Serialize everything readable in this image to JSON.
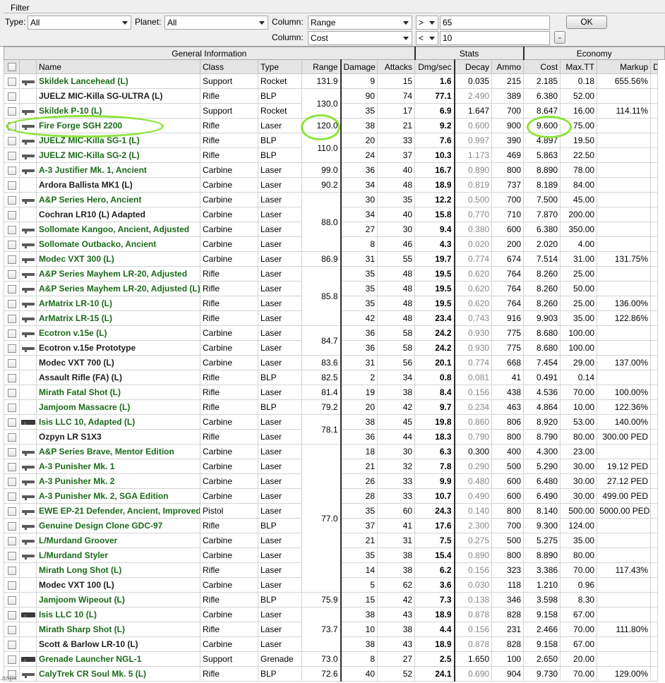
{
  "filter": {
    "title": "Filter",
    "type_label": "Type:",
    "type_value": "All",
    "planet_label": "Planet:",
    "planet_value": "All",
    "column_label": "Column:",
    "col1_value": "Range",
    "op1_value": ">",
    "val1": "65",
    "col2_value": "Cost",
    "op2_value": "<",
    "val2": "10",
    "ok_label": "OK",
    "minus_label": "-"
  },
  "groups": {
    "general": "General Information",
    "stats": "Stats",
    "economy": "Economy"
  },
  "headers": {
    "name": "Name",
    "class": "Class",
    "type": "Type",
    "range": "Range",
    "damage": "Damage",
    "attacks": "Attacks",
    "dmgsec": "Dmg/sec",
    "decay": "Decay",
    "ammo": "Ammo",
    "cost": "Cost",
    "maxtt": "Max.TT",
    "markup": "Markup",
    "dr": "Dr"
  },
  "accent": {
    "highlight": "#8ee33a",
    "name_green": "#1a6b1a"
  },
  "rows": [
    {
      "icon": "rifle-icon",
      "name": "Skildek Lancehead (L)",
      "color": "g",
      "class": "Support",
      "type": "Rocket",
      "range": "131.9",
      "damage": "9",
      "attacks": "15",
      "dmgsec": "1.6",
      "decay": "0.035",
      "decay_gray": false,
      "ammo": "215",
      "cost": "2.185",
      "maxtt": "0.18",
      "markup": "655.56%"
    },
    {
      "icon": "",
      "name": "JUELZ MIC-Killa SG-ULTRA (L)",
      "color": "k",
      "class": "Rifle",
      "type": "BLP",
      "range": "130.0",
      "range_span": 2,
      "damage": "90",
      "attacks": "74",
      "dmgsec": "77.1",
      "decay": "2.490",
      "decay_gray": true,
      "ammo": "389",
      "cost": "6.380",
      "maxtt": "52.00",
      "markup": ""
    },
    {
      "icon": "rifle-icon",
      "name": "Skildek P-10 (L)",
      "color": "g",
      "class": "Support",
      "type": "Rocket",
      "damage": "35",
      "attacks": "17",
      "dmgsec": "6.9",
      "decay": "1.647",
      "decay_gray": false,
      "ammo": "700",
      "cost": "8.647",
      "maxtt": "16.00",
      "markup": "114.11%"
    },
    {
      "icon": "rifle-icon",
      "name": "Fire Forge SGH 2200",
      "color": "g",
      "class": "Rifle",
      "type": "Laser",
      "range": "120.0",
      "damage": "38",
      "attacks": "21",
      "dmgsec": "9.2",
      "decay": "0.600",
      "decay_gray": true,
      "ammo": "900",
      "cost": "9.600",
      "maxtt": "75.00",
      "markup": ""
    },
    {
      "icon": "rifle-icon",
      "name": "JUELZ MIC-Killa SG-1 (L)",
      "color": "g",
      "class": "Rifle",
      "type": "BLP",
      "range": "110.0",
      "range_span": 2,
      "damage": "20",
      "attacks": "33",
      "dmgsec": "7.6",
      "decay": "0.997",
      "decay_gray": true,
      "ammo": "390",
      "cost": "4.897",
      "maxtt": "19.50",
      "markup": ""
    },
    {
      "icon": "rifle-icon",
      "name": "JUELZ MIC-Killa SG-2 (L)",
      "color": "g",
      "class": "Rifle",
      "type": "BLP",
      "damage": "24",
      "attacks": "37",
      "dmgsec": "10.3",
      "decay": "1.173",
      "decay_gray": true,
      "ammo": "469",
      "cost": "5.863",
      "maxtt": "22.50",
      "markup": ""
    },
    {
      "icon": "carbine-icon",
      "name": "A-3 Justifier Mk. 1, Ancient",
      "color": "g",
      "class": "Carbine",
      "type": "Laser",
      "range": "99.0",
      "damage": "36",
      "attacks": "40",
      "dmgsec": "16.7",
      "decay": "0.890",
      "decay_gray": true,
      "ammo": "800",
      "cost": "8.890",
      "maxtt": "78.00",
      "markup": ""
    },
    {
      "icon": "",
      "name": "Ardora Ballista MK1 (L)",
      "color": "k",
      "class": "Carbine",
      "type": "Laser",
      "range": "90.2",
      "damage": "34",
      "attacks": "48",
      "dmgsec": "18.9",
      "decay": "0.819",
      "decay_gray": true,
      "ammo": "737",
      "cost": "8.189",
      "maxtt": "84.00",
      "markup": ""
    },
    {
      "icon": "carbine-icon",
      "name": "A&P Series Hero, Ancient",
      "color": "g",
      "class": "Carbine",
      "type": "Laser",
      "range": "88.0",
      "range_span": 4,
      "damage": "30",
      "attacks": "35",
      "dmgsec": "12.2",
      "decay": "0.500",
      "decay_gray": true,
      "ammo": "700",
      "cost": "7.500",
      "maxtt": "45.00",
      "markup": ""
    },
    {
      "icon": "",
      "name": "Cochran LR10 (L) Adapted",
      "color": "k",
      "class": "Carbine",
      "type": "Laser",
      "damage": "34",
      "attacks": "40",
      "dmgsec": "15.8",
      "decay": "0.770",
      "decay_gray": true,
      "ammo": "710",
      "cost": "7.870",
      "maxtt": "200.00",
      "markup": ""
    },
    {
      "icon": "carbine-icon",
      "name": "Sollomate Kangoo, Ancient, Adjusted",
      "color": "g",
      "class": "Carbine",
      "type": "Laser",
      "damage": "27",
      "attacks": "30",
      "dmgsec": "9.4",
      "decay": "0.380",
      "decay_gray": true,
      "ammo": "600",
      "cost": "6.380",
      "maxtt": "350.00",
      "markup": ""
    },
    {
      "icon": "carbine-icon",
      "name": "Sollomate Outbacko, Ancient",
      "color": "g",
      "class": "Carbine",
      "type": "Laser",
      "damage": "8",
      "attacks": "46",
      "dmgsec": "4.3",
      "decay": "0.020",
      "decay_gray": true,
      "ammo": "200",
      "cost": "2.020",
      "maxtt": "4.00",
      "markup": ""
    },
    {
      "icon": "carbine-icon",
      "name": "Modec VXT 300 (L)",
      "color": "g",
      "class": "Carbine",
      "type": "Laser",
      "range": "86.9",
      "damage": "31",
      "attacks": "55",
      "dmgsec": "19.7",
      "decay": "0.774",
      "decay_gray": true,
      "ammo": "674",
      "cost": "7.514",
      "maxtt": "31.00",
      "markup": "131.75%"
    },
    {
      "icon": "rifle-icon",
      "name": "A&P Series Mayhem LR-20, Adjusted",
      "color": "g",
      "class": "Rifle",
      "type": "Laser",
      "range": "85.8",
      "range_span": 4,
      "damage": "35",
      "attacks": "48",
      "dmgsec": "19.5",
      "decay": "0.620",
      "decay_gray": true,
      "ammo": "764",
      "cost": "8.260",
      "maxtt": "25.00",
      "markup": ""
    },
    {
      "icon": "rifle-icon",
      "name": "A&P Series Mayhem LR-20, Adjusted (L)",
      "color": "g",
      "class": "Rifle",
      "type": "Laser",
      "damage": "35",
      "attacks": "48",
      "dmgsec": "19.5",
      "decay": "0.620",
      "decay_gray": true,
      "ammo": "764",
      "cost": "8.260",
      "maxtt": "50.00",
      "markup": ""
    },
    {
      "icon": "rifle-icon",
      "name": "ArMatrix LR-10 (L)",
      "color": "g",
      "class": "Rifle",
      "type": "Laser",
      "damage": "35",
      "attacks": "48",
      "dmgsec": "19.5",
      "decay": "0.620",
      "decay_gray": true,
      "ammo": "764",
      "cost": "8.260",
      "maxtt": "25.00",
      "markup": "136.00%"
    },
    {
      "icon": "rifle-icon",
      "name": "ArMatrix LR-15 (L)",
      "color": "g",
      "class": "Rifle",
      "type": "Laser",
      "damage": "42",
      "attacks": "48",
      "dmgsec": "23.4",
      "decay": "0.743",
      "decay_gray": true,
      "ammo": "916",
      "cost": "9.903",
      "maxtt": "35.00",
      "markup": "122.86%"
    },
    {
      "icon": "pistol-icon",
      "name": "Ecotron v.15e (L)",
      "color": "g",
      "class": "Carbine",
      "type": "Laser",
      "range": "84.7",
      "range_span": 2,
      "damage": "36",
      "attacks": "58",
      "dmgsec": "24.2",
      "decay": "0.930",
      "decay_gray": true,
      "ammo": "775",
      "cost": "8.680",
      "maxtt": "100.00",
      "markup": ""
    },
    {
      "icon": "pistol-icon",
      "name": "Ecotron v.15e Prototype",
      "color": "k",
      "class": "Carbine",
      "type": "Laser",
      "damage": "36",
      "attacks": "58",
      "dmgsec": "24.2",
      "decay": "0.930",
      "decay_gray": true,
      "ammo": "775",
      "cost": "8.680",
      "maxtt": "100.00",
      "markup": ""
    },
    {
      "icon": "",
      "name": "Modec VXT 700 (L)",
      "color": "k",
      "class": "Carbine",
      "type": "Laser",
      "range": "83.6",
      "damage": "31",
      "attacks": "56",
      "dmgsec": "20.1",
      "decay": "0.774",
      "decay_gray": true,
      "ammo": "668",
      "cost": "7.454",
      "maxtt": "29.00",
      "markup": "137.00%"
    },
    {
      "icon": "",
      "name": "Assault Rifle (FA) (L)",
      "color": "k",
      "class": "Rifle",
      "type": "BLP",
      "range": "82.5",
      "damage": "2",
      "attacks": "34",
      "dmgsec": "0.8",
      "decay": "0.081",
      "decay_gray": true,
      "ammo": "41",
      "cost": "0.491",
      "maxtt": "0.14",
      "markup": ""
    },
    {
      "icon": "",
      "name": "Mirath Fatal Shot (L)",
      "color": "g",
      "class": "Rifle",
      "type": "Laser",
      "range": "81.4",
      "damage": "19",
      "attacks": "38",
      "dmgsec": "8.4",
      "decay": "0.156",
      "decay_gray": true,
      "ammo": "438",
      "cost": "4.536",
      "maxtt": "70.00",
      "markup": "100.00%"
    },
    {
      "icon": "",
      "name": "Jamjoom Massacre (L)",
      "color": "g",
      "class": "Rifle",
      "type": "BLP",
      "range": "79.2",
      "damage": "20",
      "attacks": "42",
      "dmgsec": "9.7",
      "decay": "0.234",
      "decay_gray": true,
      "ammo": "463",
      "cost": "4.864",
      "maxtt": "10.00",
      "markup": "122.36%"
    },
    {
      "icon": "heavy-gun-icon",
      "name": "Isis LLC 10, Adapted (L)",
      "color": "g",
      "class": "Carbine",
      "type": "Laser",
      "range": "78.1",
      "range_span": 2,
      "damage": "38",
      "attacks": "45",
      "dmgsec": "19.8",
      "decay": "0.860",
      "decay_gray": true,
      "ammo": "806",
      "cost": "8.920",
      "maxtt": "53.00",
      "markup": "140.00%"
    },
    {
      "icon": "",
      "name": "Ozpyn LR S1X3",
      "color": "k",
      "class": "Rifle",
      "type": "Laser",
      "damage": "36",
      "attacks": "44",
      "dmgsec": "18.3",
      "decay": "0.790",
      "decay_gray": true,
      "ammo": "800",
      "cost": "8.790",
      "maxtt": "80.00",
      "markup": "300.00 PED"
    },
    {
      "icon": "carbine-icon",
      "name": "A&P Series Brave, Mentor Edition",
      "color": "g",
      "class": "Carbine",
      "type": "Laser",
      "range": "77.0",
      "range_span": 10,
      "damage": "18",
      "attacks": "30",
      "dmgsec": "6.3",
      "decay": "0.300",
      "decay_gray": false,
      "ammo": "400",
      "cost": "4.300",
      "maxtt": "23.00",
      "markup": ""
    },
    {
      "icon": "carbine-icon",
      "name": "A-3 Punisher Mk. 1",
      "color": "g",
      "class": "Carbine",
      "type": "Laser",
      "damage": "21",
      "attacks": "32",
      "dmgsec": "7.8",
      "decay": "0.290",
      "decay_gray": true,
      "ammo": "500",
      "cost": "5.290",
      "maxtt": "30.00",
      "markup": "19.12 PED"
    },
    {
      "icon": "carbine-icon",
      "name": "A-3 Punisher Mk. 2",
      "color": "g",
      "class": "Carbine",
      "type": "Laser",
      "damage": "26",
      "attacks": "33",
      "dmgsec": "9.9",
      "decay": "0.480",
      "decay_gray": true,
      "ammo": "600",
      "cost": "6.480",
      "maxtt": "30.00",
      "markup": "27.12 PED"
    },
    {
      "icon": "carbine-icon",
      "name": "A-3 Punisher Mk. 2, SGA Edition",
      "color": "g",
      "class": "Carbine",
      "type": "Laser",
      "damage": "28",
      "attacks": "33",
      "dmgsec": "10.7",
      "decay": "0.490",
      "decay_gray": true,
      "ammo": "600",
      "cost": "6.490",
      "maxtt": "30.00",
      "markup": "499.00 PED"
    },
    {
      "icon": "pistol-icon",
      "name": "EWE EP-21 Defender, Ancient, Improved",
      "color": "g",
      "class": "Pistol",
      "type": "Laser",
      "damage": "35",
      "attacks": "60",
      "dmgsec": "24.3",
      "decay": "0.140",
      "decay_gray": true,
      "ammo": "800",
      "cost": "8.140",
      "maxtt": "500.00",
      "markup": "5000.00 PED"
    },
    {
      "icon": "rifle-icon",
      "name": "Genuine Design Clone GDC-97",
      "color": "g",
      "class": "Rifle",
      "type": "BLP",
      "damage": "37",
      "attacks": "41",
      "dmgsec": "17.6",
      "decay": "2.300",
      "decay_gray": true,
      "ammo": "700",
      "cost": "9.300",
      "maxtt": "124.00",
      "markup": ""
    },
    {
      "icon": "carbine-icon",
      "name": "L/Murdand Groover",
      "color": "g",
      "class": "Carbine",
      "type": "Laser",
      "damage": "21",
      "attacks": "31",
      "dmgsec": "7.5",
      "decay": "0.275",
      "decay_gray": true,
      "ammo": "500",
      "cost": "5.275",
      "maxtt": "35.00",
      "markup": ""
    },
    {
      "icon": "carbine-icon",
      "name": "L/Murdand Styler",
      "color": "g",
      "class": "Carbine",
      "type": "Laser",
      "damage": "35",
      "attacks": "38",
      "dmgsec": "15.4",
      "decay": "0.890",
      "decay_gray": true,
      "ammo": "800",
      "cost": "8.890",
      "maxtt": "80.00",
      "markup": ""
    },
    {
      "icon": "",
      "name": "Mirath Long Shot (L)",
      "color": "g",
      "class": "Rifle",
      "type": "Laser",
      "damage": "14",
      "attacks": "38",
      "dmgsec": "6.2",
      "decay": "0.156",
      "decay_gray": true,
      "ammo": "323",
      "cost": "3.386",
      "maxtt": "70.00",
      "markup": "117.43%"
    },
    {
      "icon": "",
      "name": "Modec VXT 100 (L)",
      "color": "k",
      "class": "Carbine",
      "type": "Laser",
      "damage": "5",
      "attacks": "62",
      "dmgsec": "3.6",
      "decay": "0.030",
      "decay_gray": true,
      "ammo": "118",
      "cost": "1.210",
      "maxtt": "0.96",
      "markup": ""
    },
    {
      "icon": "",
      "name": "Jamjoom Wipeout (L)",
      "color": "g",
      "class": "Rifle",
      "type": "BLP",
      "range": "75.9",
      "damage": "15",
      "attacks": "42",
      "dmgsec": "7.3",
      "decay": "0.138",
      "decay_gray": true,
      "ammo": "346",
      "cost": "3.598",
      "maxtt": "8.30",
      "markup": ""
    },
    {
      "icon": "heavy-gun-icon",
      "name": "Isis LLC 10 (L)",
      "color": "g",
      "class": "Carbine",
      "type": "Laser",
      "range": "73.7",
      "range_span": 3,
      "damage": "38",
      "attacks": "43",
      "dmgsec": "18.9",
      "decay": "0.878",
      "decay_gray": true,
      "ammo": "828",
      "cost": "9.158",
      "maxtt": "67.00",
      "markup": ""
    },
    {
      "icon": "",
      "name": "Mirath Sharp Shot (L)",
      "color": "g",
      "class": "Rifle",
      "type": "Laser",
      "damage": "10",
      "attacks": "38",
      "dmgsec": "4.4",
      "decay": "0.156",
      "decay_gray": true,
      "ammo": "231",
      "cost": "2.466",
      "maxtt": "70.00",
      "markup": "111.80%"
    },
    {
      "icon": "",
      "name": "Scott & Barlow LR-10 (L)",
      "color": "k",
      "class": "Carbine",
      "type": "Laser",
      "damage": "38",
      "attacks": "43",
      "dmgsec": "18.9",
      "decay": "0.878",
      "decay_gray": true,
      "ammo": "828",
      "cost": "9.158",
      "maxtt": "67.00",
      "markup": ""
    },
    {
      "icon": "heavy-gun-icon",
      "name": "Grenade Launcher NGL-1",
      "color": "g",
      "class": "Support",
      "type": "Grenade",
      "range": "73.0",
      "damage": "8",
      "attacks": "27",
      "dmgsec": "2.5",
      "decay": "1.650",
      "decay_gray": false,
      "ammo": "100",
      "cost": "2.650",
      "maxtt": "20.00",
      "markup": ""
    },
    {
      "icon": "rifle-icon",
      "name": "CalyTrek CR Soul Mk. 5 (L)",
      "color": "g",
      "class": "Rifle",
      "type": "BLP",
      "range": "72.6",
      "damage": "40",
      "attacks": "52",
      "dmgsec": "24.1",
      "decay": "0.690",
      "decay_gray": true,
      "ammo": "904",
      "cost": "9.730",
      "maxtt": "70.00",
      "markup": "129.00%"
    }
  ],
  "footer_text": ".aspx"
}
